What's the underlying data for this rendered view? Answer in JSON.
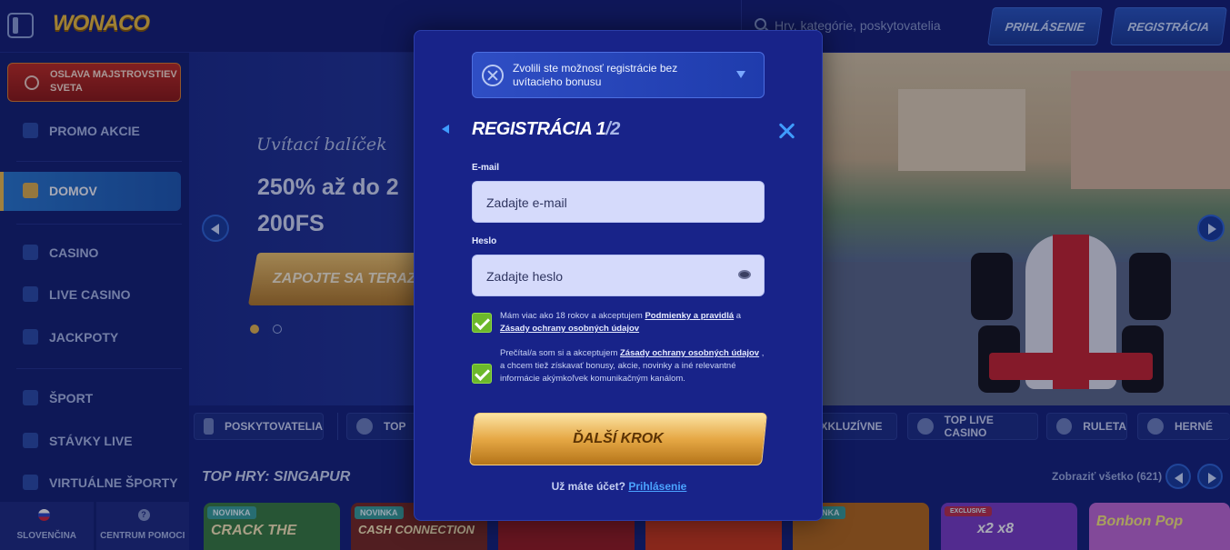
{
  "header": {
    "logo": "WONACO",
    "search_placeholder": "Hry, kategórie, poskytovatelia",
    "login_label": "PRIHLÁSENIE",
    "register_label": "REGISTRÁCIA"
  },
  "sidebar": {
    "promo_wc": "OSLAVA MAJSTROVSTIEV SVETA",
    "items": [
      {
        "label": "PROMO AKCIE",
        "icon": "gift-icon"
      },
      {
        "label": "DOMOV",
        "icon": "home-icon"
      },
      {
        "label": "CASINO",
        "icon": "slot-machine-icon"
      },
      {
        "label": "LIVE CASINO",
        "icon": "cards-icon"
      },
      {
        "label": "JACKPOTY",
        "icon": "clover-icon"
      },
      {
        "label": "ŠPORT",
        "icon": "ball-icon"
      },
      {
        "label": "STÁVKY LIVE",
        "icon": "live-icon"
      },
      {
        "label": "VIRTUÁLNE ŠPORTY",
        "icon": "virtual-icon"
      }
    ],
    "footer": {
      "language": "SLOVENČINA",
      "help": "CENTRUM POMOCI",
      "help_glyph": "?"
    }
  },
  "hero": {
    "subtitle": "Uvítací balíček",
    "title": "250% až do 2 200FS",
    "cta": "ZAPOJTE SA TERAZ"
  },
  "categories": [
    {
      "label": "POSKYTOVATELIA"
    },
    {
      "label": "TOP"
    },
    {
      "label": "EXKLUZÍVNE"
    },
    {
      "label": "TOP LIVE CASINO"
    },
    {
      "label": "RULETA"
    },
    {
      "label": "HERNÉ"
    }
  ],
  "top_games": {
    "title": "TOP HRY: SINGAPUR",
    "show_all": "Zobraziť všetko (621)",
    "games": [
      {
        "badge": "NOVINKA",
        "title": "CRACK THE",
        "color": "#3a7e3c"
      },
      {
        "badge": "NOVINKA",
        "title": "CASH CONNECTION",
        "color": "#7a2a1e"
      },
      {
        "badge": "",
        "title": "",
        "color": "#9a1c1c"
      },
      {
        "badge": "",
        "title": "",
        "color": "#d23a16"
      },
      {
        "badge": "NOVINKA",
        "title": "",
        "color": "#b86a16"
      },
      {
        "badge": "EXCLUSIVE",
        "title": "x2  x8",
        "color": "#7b3ec7"
      },
      {
        "badge": "",
        "title": "Bonbon Pop",
        "color": "#c56cd6"
      }
    ]
  },
  "modal": {
    "bonus_text": "Zvolili ste možnosť registrácie bez uvítacieho bonusu",
    "title": "REGISTRÁCIA 1",
    "step": "/2",
    "email_label": "E-mail",
    "email_placeholder": "Zadajte e-mail",
    "password_label": "Heslo",
    "password_placeholder": "Zadajte heslo",
    "consent1_text": "Mám viac ako 18 rokov a akceptujem ",
    "consent1_link1": "Podmienky a pravidlá",
    "consent1_and": " a ",
    "consent1_link2": "Zásady ochrany osobných údajov",
    "consent2_text": "Prečítal/a som si a akceptujem ",
    "consent2_link": "Zásady ochrany osobných údajov",
    "consent2_rest": " , a chcem tiež získavať bonusy, akcie, novinky a iné relevantné informácie akýmkoľvek komunikačným kanálom.",
    "next_label": "ĎALŠÍ KROK",
    "login_prompt": "Už máte účet?",
    "login_link": "Prihlásenie"
  }
}
